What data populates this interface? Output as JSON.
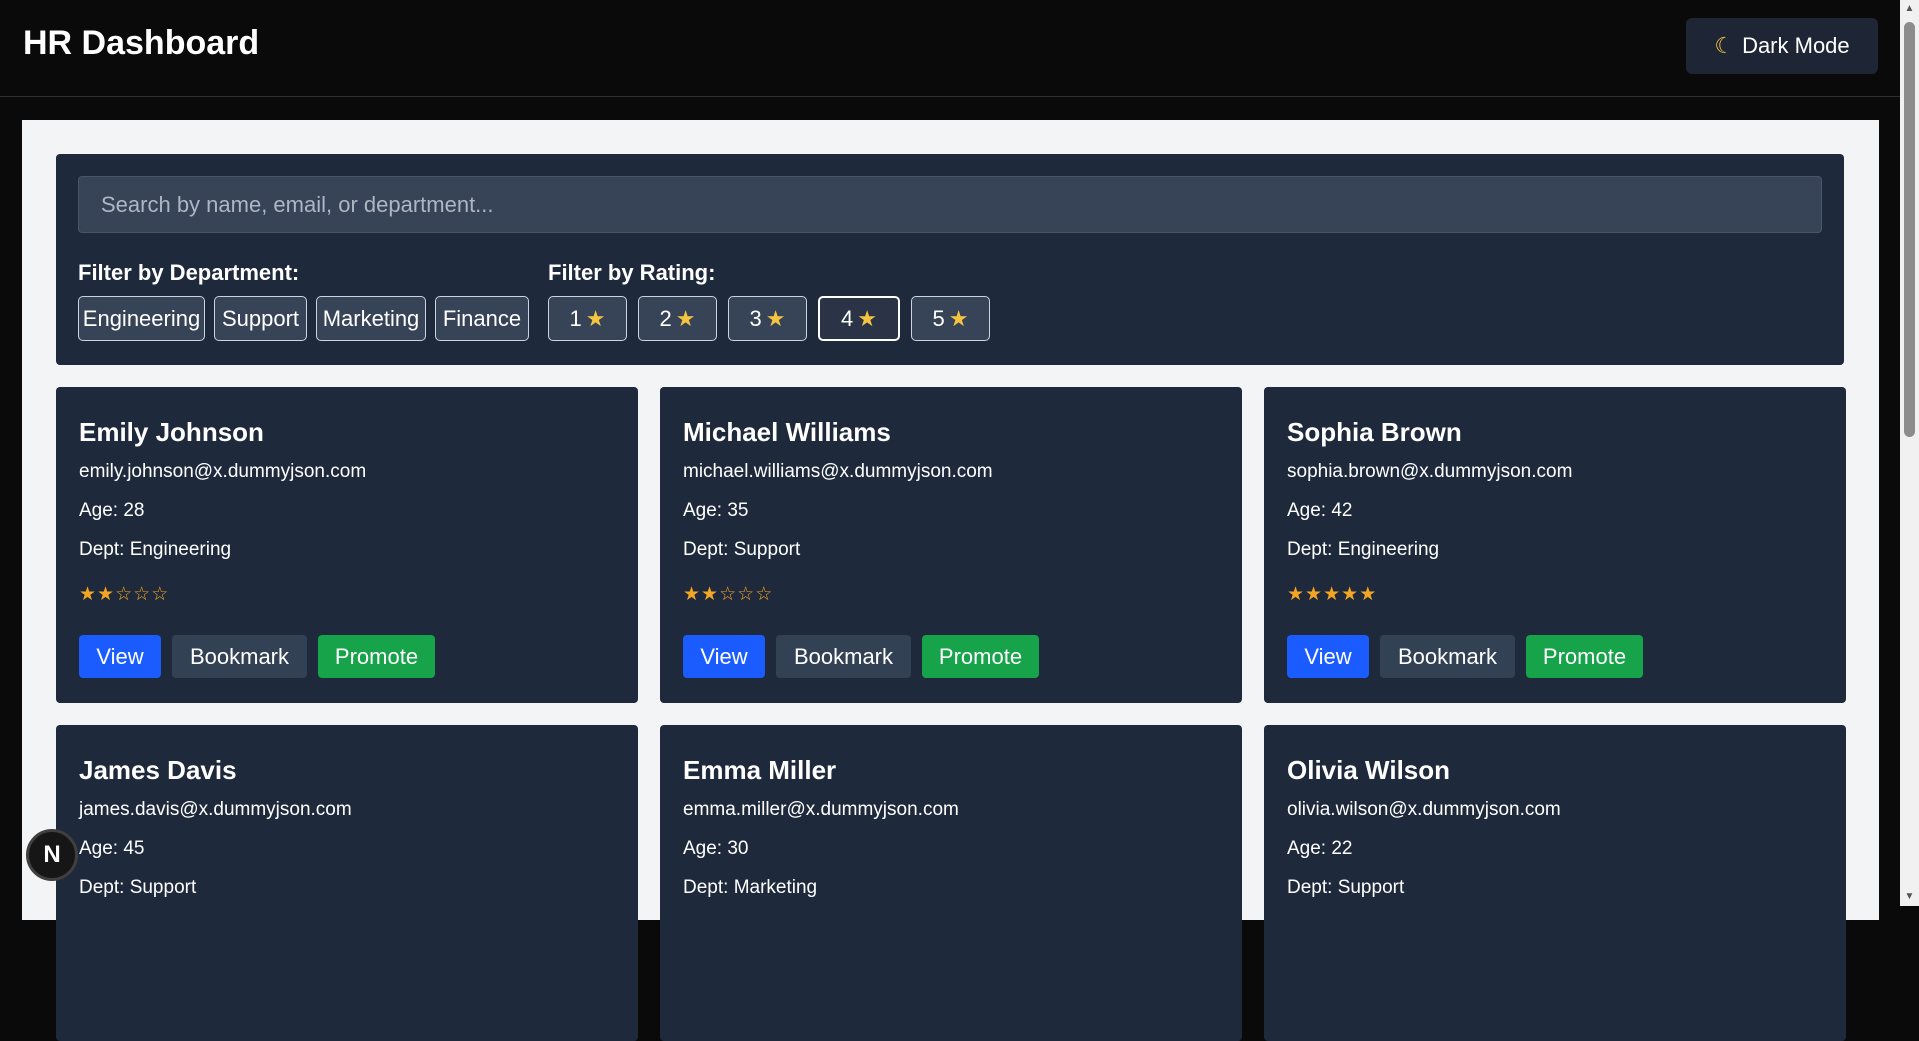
{
  "header": {
    "title": "HR Dashboard",
    "toggle_icon": "moon-icon",
    "toggle_label": "Dark Mode"
  },
  "filters": {
    "search_placeholder": "Search by name, email, or department...",
    "search_value": "",
    "department_label": "Filter by Department:",
    "departments": [
      "Engineering",
      "Support",
      "Marketing",
      "Finance"
    ],
    "rating_label": "Filter by Rating:",
    "ratings": [
      "1",
      "2",
      "3",
      "4",
      "5"
    ],
    "rating_icon": "star-icon",
    "active_rating": "4"
  },
  "employees": [
    {
      "name": "Emily Johnson",
      "email": "emily.johnson@x.dummyjson.com",
      "age": "Age: 28",
      "dept": "Dept: Engineering",
      "rating": 2
    },
    {
      "name": "Michael Williams",
      "email": "michael.williams@x.dummyjson.com",
      "age": "Age: 35",
      "dept": "Dept: Support",
      "rating": 2
    },
    {
      "name": "Sophia Brown",
      "email": "sophia.brown@x.dummyjson.com",
      "age": "Age: 42",
      "dept": "Dept: Engineering",
      "rating": 5
    },
    {
      "name": "James Davis",
      "email": "james.davis@x.dummyjson.com",
      "age": "Age: 45",
      "dept": "Dept: Support",
      "rating": null
    },
    {
      "name": "Emma Miller",
      "email": "emma.miller@x.dummyjson.com",
      "age": "Age: 30",
      "dept": "Dept: Marketing",
      "rating": null
    },
    {
      "name": "Olivia Wilson",
      "email": "olivia.wilson@x.dummyjson.com",
      "age": "Age: 22",
      "dept": "Dept: Support",
      "rating": null
    }
  ],
  "card_actions": {
    "view": "View",
    "bookmark": "Bookmark",
    "promote": "Promote"
  },
  "dev_badge": "N",
  "colors": {
    "page_bg": "#0a0a0a",
    "panel_bg": "#1e293b",
    "content_bg": "#f2f4f6",
    "view_button": "#1a5cff",
    "bookmark_button": "#334155",
    "promote_button": "#16a34a",
    "star": "#f5a524"
  }
}
